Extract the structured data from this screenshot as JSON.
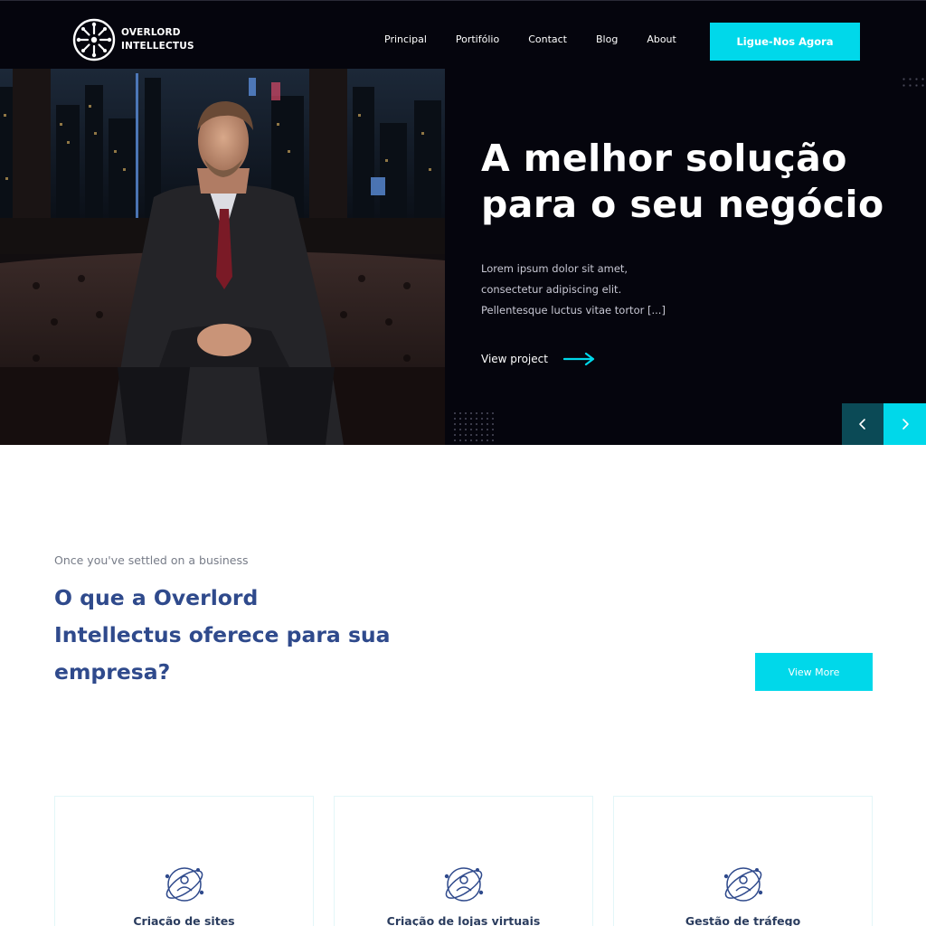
{
  "brand": {
    "line1": "OVERLORD",
    "line2": "INTELLECTUS"
  },
  "nav": [
    {
      "label": "Principal"
    },
    {
      "label": "Portifólio"
    },
    {
      "label": "Contact"
    },
    {
      "label": "Blog"
    },
    {
      "label": "About"
    }
  ],
  "header": {
    "cta_label": "Ligue-Nos Agora"
  },
  "hero": {
    "title_line1": "A melhor solução",
    "title_line2": "para o seu negócio",
    "text_line1": "Lorem ipsum dolor sit amet,",
    "text_line2": "consectetur adipiscing elit.",
    "text_line3": "Pellentesque luctus vitae tortor [...]",
    "link_label": "View project"
  },
  "services": {
    "eyebrow": "Once you've settled on a business",
    "title_line1": "O que a Overlord",
    "title_line2": "Intellectus oferece para sua",
    "title_line3": "empresa?",
    "view_more_label": "View More",
    "cards": [
      {
        "title": "Criação de sites"
      },
      {
        "title": "Criação de lojas virtuais"
      },
      {
        "title": "Gestão de tráfego"
      }
    ]
  },
  "colors": {
    "accent": "#00d8ea",
    "dark": "#05050d",
    "heading": "#2f4a8c",
    "slider_prev": "#0b4a56"
  },
  "icons": {
    "logo": "compass-logo-icon",
    "link_arrow": "arrow-right-icon",
    "prev": "chevron-left-icon",
    "next": "chevron-right-icon",
    "card": "orbit-user-icon"
  }
}
